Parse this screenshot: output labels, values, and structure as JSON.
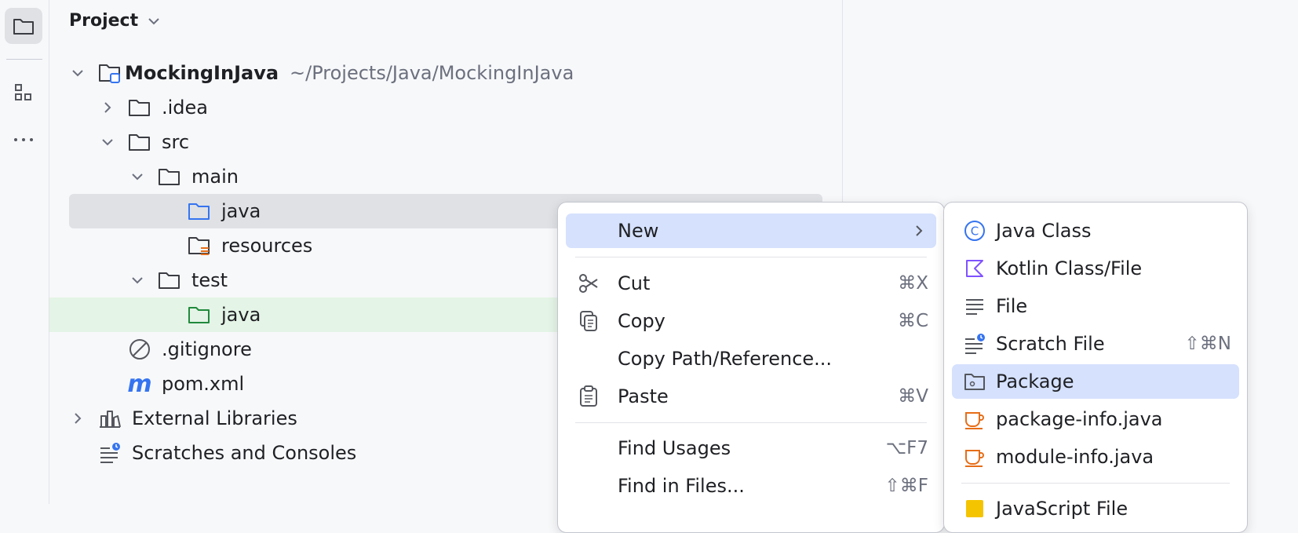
{
  "panel": {
    "title": "Project"
  },
  "tree": [
    {
      "label": "MockingInJava",
      "path": "~/Projects/Java/MockingInJava"
    },
    {
      "label": ".idea"
    },
    {
      "label": "src"
    },
    {
      "label": "main"
    },
    {
      "label": "java"
    },
    {
      "label": "resources"
    },
    {
      "label": "test"
    },
    {
      "label": "java"
    },
    {
      "label": ".gitignore"
    },
    {
      "label": "pom.xml"
    },
    {
      "label": "External Libraries"
    },
    {
      "label": "Scratches and Consoles"
    }
  ],
  "context_menu": {
    "items": [
      {
        "label": "New",
        "shortcut": ""
      },
      {
        "label": "Cut",
        "shortcut": "⌘X"
      },
      {
        "label": "Copy",
        "shortcut": "⌘C"
      },
      {
        "label": "Copy Path/Reference...",
        "shortcut": ""
      },
      {
        "label": "Paste",
        "shortcut": "⌘V"
      },
      {
        "label": "Find Usages",
        "shortcut": "⌥F7"
      },
      {
        "label": "Find in Files...",
        "shortcut": "⇧⌘F"
      }
    ]
  },
  "submenu": {
    "items": [
      {
        "label": "Java Class",
        "shortcut": ""
      },
      {
        "label": "Kotlin Class/File",
        "shortcut": ""
      },
      {
        "label": "File",
        "shortcut": ""
      },
      {
        "label": "Scratch File",
        "shortcut": "⇧⌘N"
      },
      {
        "label": "Package",
        "shortcut": ""
      },
      {
        "label": "package-info.java",
        "shortcut": ""
      },
      {
        "label": "module-info.java",
        "shortcut": ""
      },
      {
        "label": "JavaScript File",
        "shortcut": ""
      }
    ]
  },
  "colors": {
    "selected_row": "#dfe1e5",
    "test_row": "#e4f4e6",
    "menu_selected": "#d5e1fd",
    "source_folder": "#3574f0",
    "test_folder": "#208a3c",
    "kotlin": "#7f52ff",
    "java_file": "#e66d17"
  }
}
